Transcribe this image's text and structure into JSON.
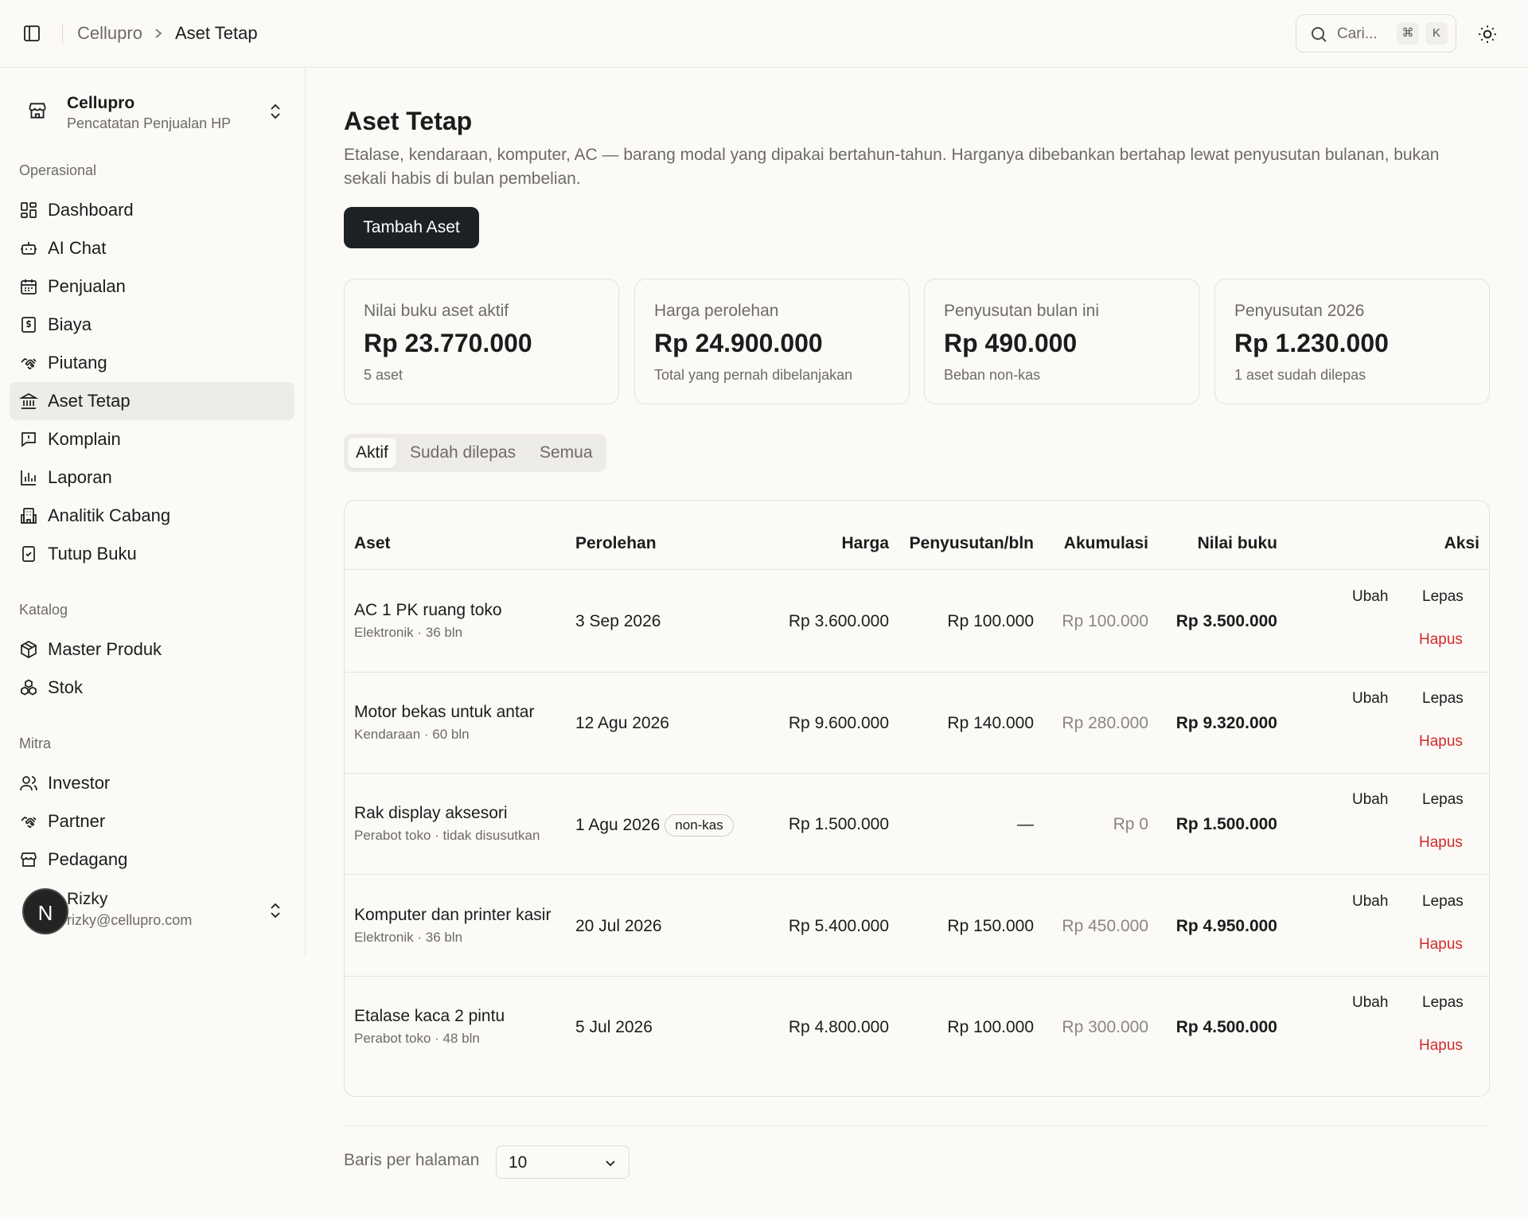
{
  "topbar": {
    "breadcrumb_root": "Cellupro",
    "breadcrumb_current": "Aset Tetap",
    "search_placeholder": "Cari...",
    "shortcut_mod": "⌘",
    "shortcut_key": "K"
  },
  "sidebar": {
    "brand_name": "Cellupro",
    "brand_subtitle": "Pencatatan Penjualan HP",
    "groups": [
      {
        "label": "Operasional",
        "items": [
          {
            "label": "Dashboard",
            "icon": "dashboard-icon"
          },
          {
            "label": "AI Chat",
            "icon": "bot-icon"
          },
          {
            "label": "Penjualan",
            "icon": "calendar-icon"
          },
          {
            "label": "Biaya",
            "icon": "receipt-icon"
          },
          {
            "label": "Piutang",
            "icon": "handshake-icon"
          },
          {
            "label": "Aset Tetap",
            "icon": "landmark-icon",
            "active": true
          },
          {
            "label": "Komplain",
            "icon": "message-alert-icon"
          },
          {
            "label": "Laporan",
            "icon": "bar-chart-icon"
          },
          {
            "label": "Analitik Cabang",
            "icon": "building-icon"
          },
          {
            "label": "Tutup Buku",
            "icon": "clipboard-check-icon"
          }
        ]
      },
      {
        "label": "Katalog",
        "items": [
          {
            "label": "Master Produk",
            "icon": "package-icon"
          },
          {
            "label": "Stok",
            "icon": "boxes-icon"
          }
        ]
      },
      {
        "label": "Mitra",
        "items": [
          {
            "label": "Investor",
            "icon": "users-icon"
          },
          {
            "label": "Partner",
            "icon": "handshake-icon"
          },
          {
            "label": "Pedagang",
            "icon": "store-icon"
          }
        ]
      }
    ],
    "user": {
      "initial": "N",
      "name": "Rizky",
      "email": "rizky@cellupro.com"
    }
  },
  "main": {
    "title": "Aset Tetap",
    "description": "Etalase, kendaraan, komputer, AC — barang modal yang dipakai bertahun-tahun. Harganya dibebankan bertahap lewat penyusutan bulanan, bukan sekali habis di bulan pembelian.",
    "add_button": "Tambah Aset",
    "cards": [
      {
        "label": "Nilai buku aset aktif",
        "value": "Rp 23.770.000",
        "sub": "5 aset"
      },
      {
        "label": "Harga perolehan",
        "value": "Rp 24.900.000",
        "sub": "Total yang pernah dibelanjakan"
      },
      {
        "label": "Penyusutan bulan ini",
        "value": "Rp 490.000",
        "sub": "Beban non-kas"
      },
      {
        "label": "Penyusutan 2026",
        "value": "Rp 1.230.000",
        "sub": "1 aset sudah dilepas"
      }
    ],
    "tabs": [
      "Aktif",
      "Sudah dilepas",
      "Semua"
    ],
    "table": {
      "headers": {
        "aset": "Aset",
        "perolehan": "Perolehan",
        "harga": "Harga",
        "penyusutan": "Penyusutan/bln",
        "akumulasi": "Akumulasi",
        "nilai_buku": "Nilai buku",
        "aksi": "Aksi"
      },
      "actions": {
        "edit": "Ubah",
        "dispose": "Lepas",
        "delete": "Hapus"
      },
      "rows": [
        {
          "name": "AC 1 PK ruang toko",
          "meta": "Elektronik · 36 bln",
          "date": "3 Sep 2026",
          "badge": "",
          "price": "Rp 3.600.000",
          "dep": "Rp 100.000",
          "acc": "Rp 100.000",
          "book": "Rp 3.500.000"
        },
        {
          "name": "Motor bekas untuk antar",
          "meta": "Kendaraan · 60 bln",
          "date": "12 Agu 2026",
          "badge": "",
          "price": "Rp 9.600.000",
          "dep": "Rp 140.000",
          "acc": "Rp 280.000",
          "book": "Rp 9.320.000"
        },
        {
          "name": "Rak display aksesori",
          "meta": "Perabot toko · tidak disusutkan",
          "date": "1 Agu 2026",
          "badge": "non-kas",
          "price": "Rp 1.500.000",
          "dep": "—",
          "acc": "Rp 0",
          "book": "Rp 1.500.000"
        },
        {
          "name": "Komputer dan printer kasir",
          "meta": "Elektronik · 36 bln",
          "date": "20 Jul 2026",
          "badge": "",
          "price": "Rp 5.400.000",
          "dep": "Rp 150.000",
          "acc": "Rp 450.000",
          "book": "Rp 4.950.000"
        },
        {
          "name": "Etalase kaca 2 pintu",
          "meta": "Perabot toko · 48 bln",
          "date": "5 Jul 2026",
          "badge": "",
          "price": "Rp 4.800.000",
          "dep": "Rp 100.000",
          "acc": "Rp 300.000",
          "book": "Rp 4.500.000"
        }
      ]
    },
    "pagination": {
      "rows_label": "Baris per halaman",
      "rows_value": "10"
    }
  }
}
